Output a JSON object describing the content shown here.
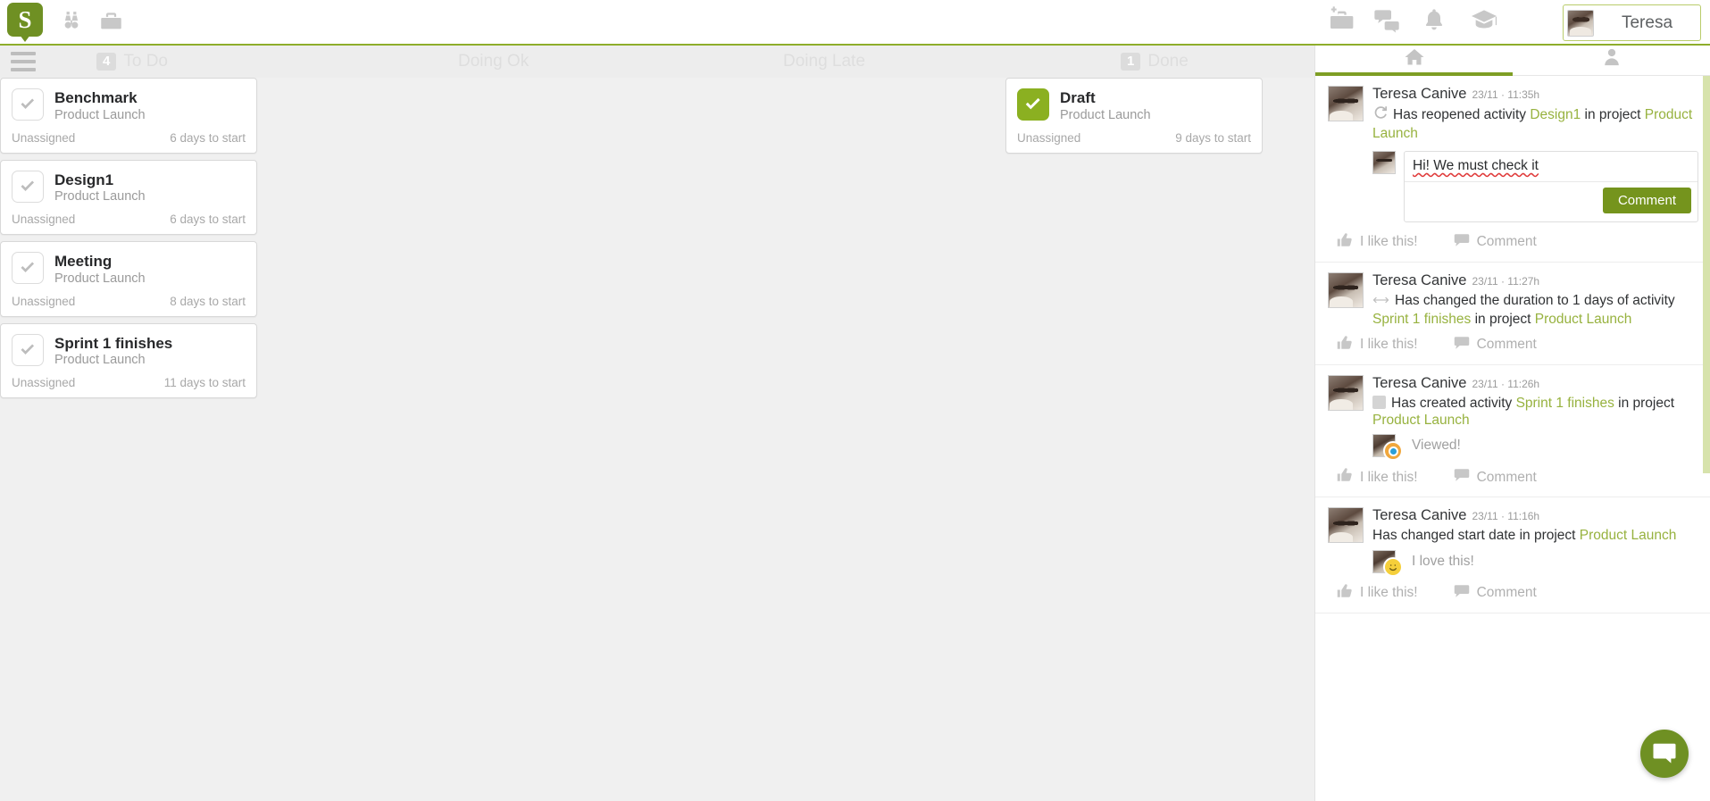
{
  "topbar": {
    "logo_letter": "S",
    "icons": [
      {
        "name": "binoculars-icon",
        "label": "Search projects"
      },
      {
        "name": "briefcase-icon",
        "label": "Projects"
      }
    ],
    "right_icons": [
      {
        "name": "add-project-icon",
        "label": "New project"
      },
      {
        "name": "chat-icon",
        "label": "Messages"
      },
      {
        "name": "bell-icon",
        "label": "Notifications"
      },
      {
        "name": "graduation-cap-icon",
        "label": "Training"
      }
    ],
    "user": {
      "name": "Teresa",
      "avatar": "user-avatar"
    }
  },
  "board": {
    "menu_icon": "hamburger-menu-icon",
    "columns": [
      {
        "id": "todo",
        "title": "To Do",
        "count": "4"
      },
      {
        "id": "doing-ok",
        "title": "Doing Ok",
        "count": ""
      },
      {
        "id": "doing-late",
        "title": "Doing Late",
        "count": ""
      },
      {
        "id": "done",
        "title": "Done",
        "count": "1"
      }
    ],
    "cards": {
      "todo": [
        {
          "title": "Benchmark",
          "project": "Product Launch",
          "assignee": "Unassigned",
          "due": "6 days to start",
          "state": "todo"
        },
        {
          "title": "Design1",
          "project": "Product Launch",
          "assignee": "Unassigned",
          "due": "6 days to start",
          "state": "todo"
        },
        {
          "title": "Meeting",
          "project": "Product Launch",
          "assignee": "Unassigned",
          "due": "8 days to start",
          "state": "todo"
        },
        {
          "title": "Sprint 1 finishes",
          "project": "Product Launch",
          "assignee": "Unassigned",
          "due": "11 days to start",
          "state": "todo"
        }
      ],
      "done": [
        {
          "title": "Draft",
          "project": "Product Launch",
          "assignee": "Unassigned",
          "due": "9 days to start",
          "state": "done"
        }
      ]
    }
  },
  "feed": {
    "tabs": [
      {
        "id": "home",
        "icon": "home-icon",
        "active": true
      },
      {
        "id": "person",
        "icon": "person-icon",
        "active": false
      }
    ],
    "like_label": "I like this!",
    "comment_label": "Comment",
    "items": [
      {
        "author": "Teresa Canive",
        "time": "23/11 · 11:35h",
        "icon": "refresh-icon",
        "msg_pre": "Has reopened activity ",
        "link1": "Design1",
        "msg_mid": " in project ",
        "link2": "Product Launch",
        "composer": {
          "value": "Hi! We must check it",
          "button": "Comment"
        }
      },
      {
        "author": "Teresa Canive",
        "time": "23/11 · 11:27h",
        "icon": "arrows-horizontal-icon",
        "msg_pre": "Has changed the duration to 1 days of activity ",
        "link1": "Sprint 1 finishes",
        "msg_mid": " in project ",
        "link2": "Product Launch"
      },
      {
        "author": "Teresa Canive",
        "time": "23/11 · 11:26h",
        "icon": "square-icon",
        "msg_pre": "Has created activity ",
        "link1": "Sprint 1 finishes",
        "msg_mid": " in project ",
        "link2": "Product Launch",
        "reaction": {
          "badge": "eye-icon",
          "label": "Viewed!"
        }
      },
      {
        "author": "Teresa Canive",
        "time": "23/11 · 11:16h",
        "icon": "",
        "msg_pre": "Has changed start date in project ",
        "link1": "",
        "msg_mid": "",
        "link2": "Product Launch",
        "reaction": {
          "badge": "smiley-icon",
          "label": "I love this!"
        }
      }
    ],
    "chat_widget": "chat-bubble-icon"
  },
  "colors": {
    "brand_green": "#6f9023",
    "accent_green": "#8bb021",
    "link_green": "#97b23f",
    "board_bg": "#f0f0f0"
  }
}
